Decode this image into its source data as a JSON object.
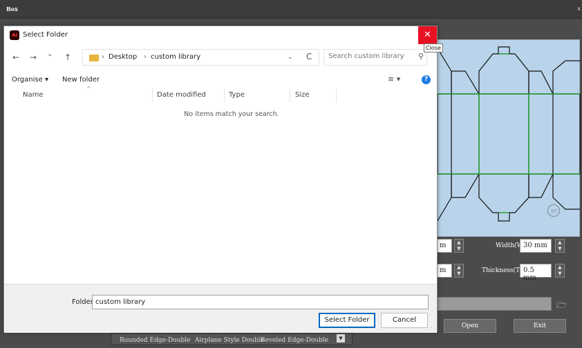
{
  "app": {
    "title": "Box",
    "close_glyph": "x",
    "preview_3d_label": "3D",
    "params": {
      "unit_left_1": "m",
      "unit_left_2": "m",
      "width_label": "Width(W):",
      "width_value": "30 mm",
      "thickness_label": "Thickness(TH):",
      "thickness_value": "0.5 mm"
    },
    "buttons": {
      "open": "Open",
      "exit": "Exit"
    },
    "styles": [
      "Rounded Edge-Double",
      "Airplane Style Double",
      "Beveled Edge-Double"
    ]
  },
  "dialog": {
    "title": "Select Folder",
    "app_icon_text": "Ai",
    "close_glyph": "✕",
    "close_tooltip": "Close",
    "nav": {
      "back": "←",
      "forward": "→",
      "recent": "⌄",
      "up": "↑",
      "dropdown": "⌄",
      "refresh": "C"
    },
    "breadcrumb": [
      "Desktop",
      "custom library"
    ],
    "breadcrumb_sep": "›",
    "search_placeholder": "Search custom library",
    "toolbar": {
      "organise": "Organise ▾",
      "new_folder": "New folder",
      "view": "≡ ▾",
      "help": "?"
    },
    "columns": [
      "Name",
      "Date modified",
      "Type",
      "Size"
    ],
    "empty_message": "No items match your search.",
    "folder_label": "Folder:",
    "folder_value": "custom library",
    "select_button": "Select Folder",
    "cancel_button": "Cancel"
  },
  "colors": {
    "close_red": "#e81123",
    "accent_blue": "#0067c0",
    "preview_bg": "#b9d4ea",
    "fold_line": "#1a9a2a"
  }
}
